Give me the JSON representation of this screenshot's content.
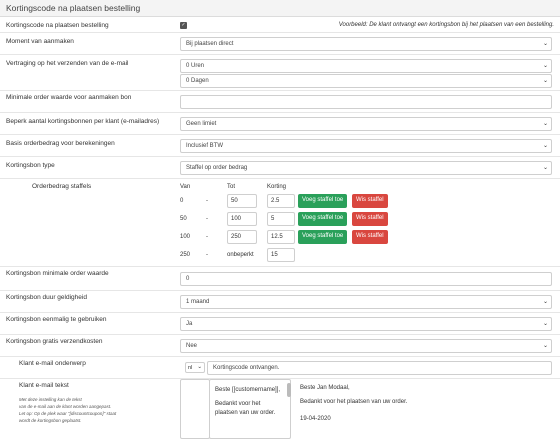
{
  "header": {
    "title": "Kortingscode na plaatsen bestelling"
  },
  "enable": {
    "label": "Kortingscode na plaatsen bestelling",
    "checked_glyph": "✓",
    "example": "Voorbeeld: De klant ontvangt een kortingsbon bij het plaatsen van een bestelling."
  },
  "moment": {
    "label": "Moment van aanmaken",
    "value": "Bij plaatsen direct"
  },
  "delay": {
    "label": "Vertraging op het verzenden van de e-mail",
    "hours": "0 Uren",
    "days": "0 Dagen"
  },
  "min_order": {
    "label": "Minimale order waarde voor aanmaken bon",
    "value": ""
  },
  "limit": {
    "label": "Beperk aantal kortingsbonnen per klant (e-mailadres)",
    "value": "Geen limiet"
  },
  "basis": {
    "label": "Basis orderbedrag voor berekeningen",
    "value": "Inclusief BTW"
  },
  "type": {
    "label": "Kortingsbon type",
    "value": "Staffel op order bedrag"
  },
  "tiers": {
    "label": "Orderbedrag staffels",
    "col_from": "Van",
    "col_to": "Tot",
    "col_discount": "Korting",
    "add_label": "Voeg staffel toe",
    "remove_label": "Wis staffel",
    "dash": "-",
    "rows": [
      {
        "from": "0",
        "to": "50",
        "discount": "2.5"
      },
      {
        "from": "50",
        "to": "100",
        "discount": "5"
      },
      {
        "from": "100",
        "to": "250",
        "discount": "12.5"
      }
    ],
    "last": {
      "from": "250",
      "to": "onbeperkt",
      "discount": "15"
    }
  },
  "min_value": {
    "label": "Kortingsbon minimale order waarde",
    "value": "0"
  },
  "duration": {
    "label": "Kortingsbon duur geldigheid",
    "value": "1 maand"
  },
  "once": {
    "label": "Kortingsbon eenmalig te gebruiken",
    "value": "Ja"
  },
  "free_shipping": {
    "label": "Kortingsbon gratis verzendkosten",
    "value": "Nee"
  },
  "subject": {
    "label": "Klant e-mail onderwerp",
    "lang": "nl",
    "value": "Kortingscode ontvangen."
  },
  "email_text": {
    "label": "Klant e-mail tekst",
    "hint1": "Met deze instelling kan de tekst",
    "hint2": "van de e-mail aan de klant worden aangepast.",
    "hint3": "Let op: Op de plek waar \"[discountcoupon]\" staat",
    "hint4": "wordt de kortingsbon geplaatst.",
    "editor_line1": "Beste [[customername]],",
    "editor_line2": "Bedankt voor het",
    "editor_line3": "plaatsen van uw order.",
    "preview_line1": "Beste Jan Modaal,",
    "preview_line2": "Bedankt voor het plaatsen van uw order.",
    "preview_line3": "19-04-2020"
  },
  "icons": {
    "chevron": "chevron-down-icon",
    "check": "check-icon"
  }
}
